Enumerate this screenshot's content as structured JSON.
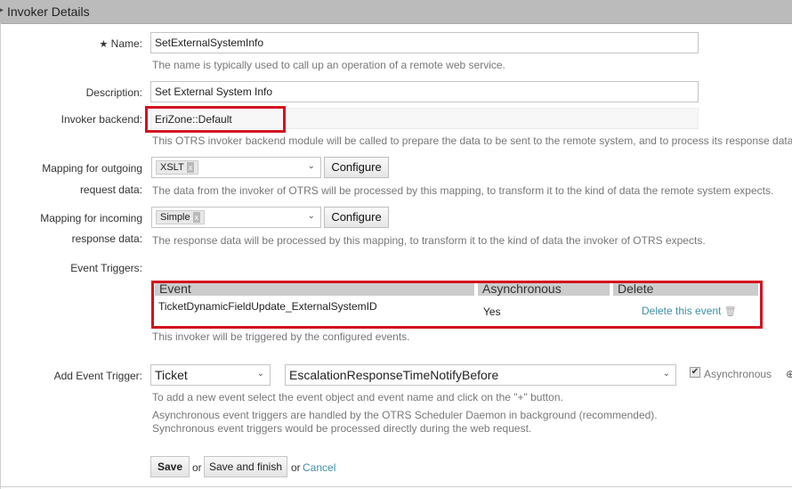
{
  "header": {
    "title": "Invoker Details"
  },
  "fields": {
    "name": {
      "required_mark": "★",
      "label": "Name:",
      "value": "SetExternalSystemInfo",
      "hint": "The name is typically used to call up an operation of a remote web service."
    },
    "description": {
      "label": "Description:",
      "value": "Set External System Info"
    },
    "backend": {
      "label": "Invoker backend:",
      "value": "EriZone::Default",
      "hint": "This OTRS invoker backend module will be called to prepare the data to be sent to the remote system, and to process its response data."
    },
    "outgoing": {
      "label_line1": "Mapping for outgoing",
      "label_line2": "request data:",
      "selected": "XSLT",
      "tag_remove": "x",
      "configure_label": "Configure",
      "hint": "The data from the invoker of OTRS will be processed by this mapping, to transform it to the kind of data the remote system expects."
    },
    "incoming": {
      "label_line1": "Mapping for incoming",
      "label_line2": "response data:",
      "selected": "Simple",
      "tag_remove": "x",
      "configure_label": "Configure",
      "hint": "The response data will be processed by this mapping, to transform it to the kind of data the invoker of OTRS expects."
    }
  },
  "event_triggers": {
    "label": "Event Triggers:",
    "columns": [
      "Event",
      "Asynchronous",
      "Delete"
    ],
    "rows": [
      {
        "event": "TicketDynamicFieldUpdate_ExternalSystemID",
        "asynchronous": "Yes",
        "delete_label": "Delete this event"
      }
    ],
    "hint": "This invoker will be triggered by the configured events."
  },
  "add_event": {
    "label": "Add Event Trigger:",
    "object_value": "Ticket",
    "event_value": "EscalationResponseTimeNotifyBefore",
    "async_label": "Asynchronous",
    "async_checked": true,
    "hint1": "To add a new event select the event object and event name and click on the \"+\" button.",
    "hint2": "Asynchronous event triggers are handled by the OTRS Scheduler Daemon in background (recommended).",
    "hint3": "Synchronous event triggers would be processed directly during the web request."
  },
  "actions": {
    "save_label": "Save",
    "or1": "or",
    "save_finish_label": "Save and finish",
    "or2": "or",
    "cancel_label": "Cancel"
  },
  "colors": {
    "highlight": "#d3121f",
    "link": "#3f8fa6",
    "header_bg": "#bbbbbb"
  },
  "icons": {
    "chevron": "chevron-down-icon",
    "trash": "trash-icon",
    "checkbox": "checkbox-icon",
    "add": "plus-icon"
  }
}
